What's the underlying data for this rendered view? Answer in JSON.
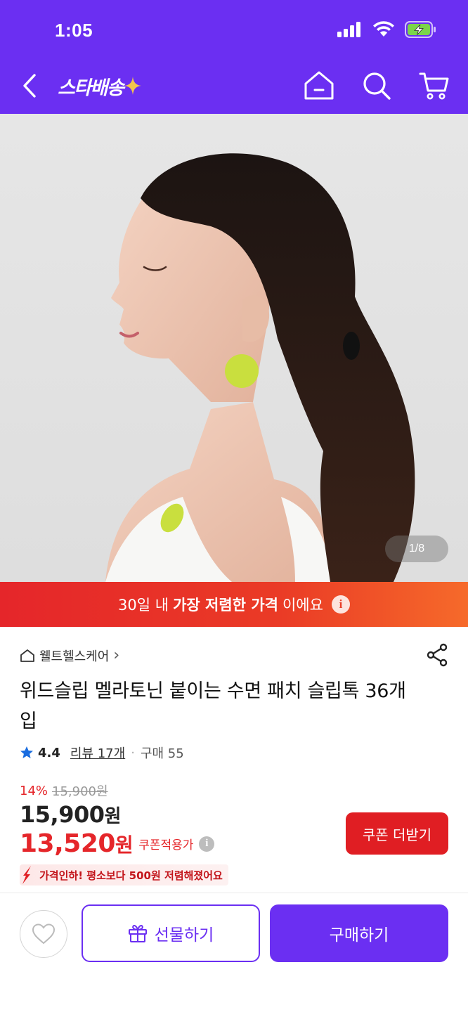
{
  "status_bar": {
    "time": "1:05"
  },
  "header": {
    "logo_text": "스타배송",
    "brand_color": "#6b2ff2",
    "icons": [
      "chevron-left-icon",
      "home-icon",
      "search-icon",
      "cart-icon"
    ]
  },
  "hero": {
    "image_counter": "1/8"
  },
  "promo": {
    "prefix": "30일 내",
    "highlight": "가장 저렴한 가격",
    "suffix": "이에요",
    "info_glyph": "i"
  },
  "product": {
    "brand": "웰트헬스케어",
    "brand_chevron": "›",
    "title": "위드슬립 멜라토닌 붙이는 수면 패치 슬립톡 36개입",
    "rating": "4.4",
    "review_label": "리뷰 17개",
    "separator": "·",
    "purchase_label": "구매 55",
    "discount_rate": "14%",
    "original_price": "15,900원",
    "price": "15,900",
    "price_unit": "원",
    "coupon_price": "13,520",
    "coupon_price_unit": "원",
    "coupon_label": "쿠폰적용가",
    "coupon_info_glyph": "i",
    "coupon_button": "쿠폰 더받기",
    "price_drop_text": "가격인하! 평소보다 500원 저렴해졌어요",
    "accent_red": "#e5262a"
  },
  "bottom_bar": {
    "gift_label": "선물하기",
    "buy_label": "구매하기"
  }
}
